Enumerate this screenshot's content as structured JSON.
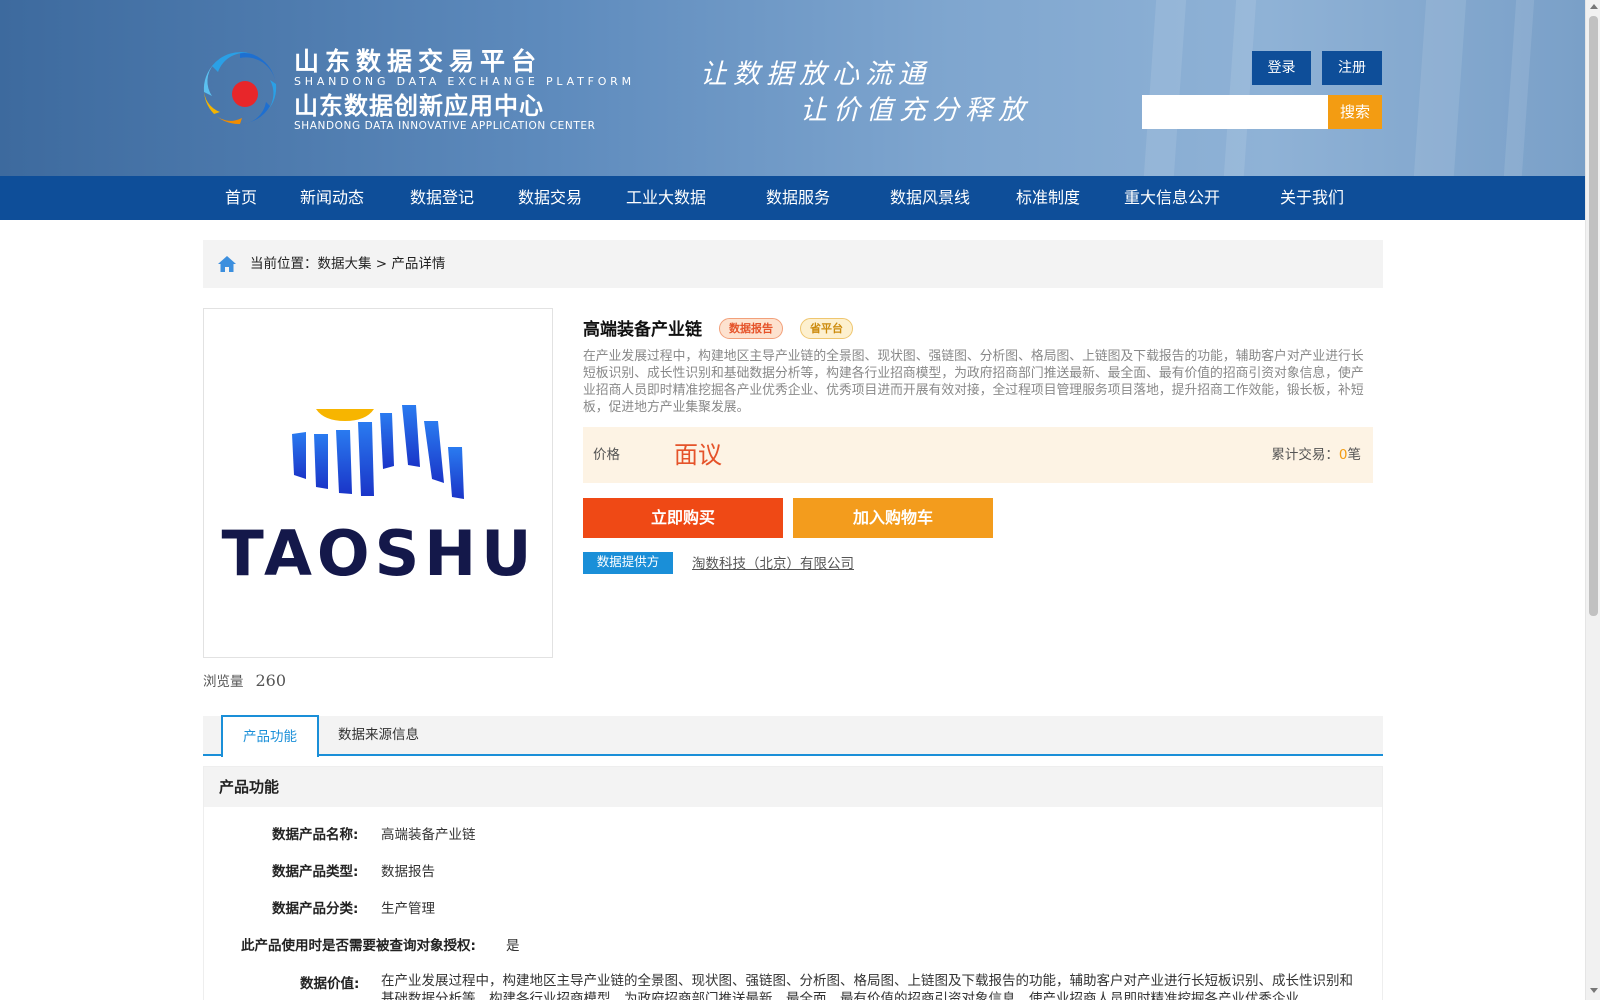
{
  "header": {
    "brand": {
      "line1": "山东数据交易平台",
      "line2": "SHANDONG DATA EXCHANGE PLATFORM",
      "line3": "山东数据创新应用中心",
      "line4": "SHANDONG DATA INNOVATIVE APPLICATION CENTER"
    },
    "slogan": {
      "line1": "让数据放心流通",
      "line2": "让价值充分释放"
    },
    "login_label": "登录",
    "register_label": "注册",
    "search_placeholder": "",
    "search_label": "搜索"
  },
  "nav": {
    "items": [
      {
        "label": "首页"
      },
      {
        "label": "新闻动态"
      },
      {
        "label": "数据登记"
      },
      {
        "label": "数据交易"
      },
      {
        "label": "工业大数据"
      },
      {
        "label": "数据服务"
      },
      {
        "label": "数据风景线"
      },
      {
        "label": "标准制度"
      },
      {
        "label": "重大信息公开"
      },
      {
        "label": "关于我们"
      }
    ]
  },
  "breadcrumb": {
    "prefix": "当前位置：",
    "level1": "数据大集",
    "separator": " > ",
    "level2": "产品详情"
  },
  "product": {
    "image_text": "TAOSHU",
    "views_label": "浏览量",
    "views_count": "260",
    "title": "高端装备产业链",
    "tags": [
      "数据报告",
      "省平台"
    ],
    "description": "在产业发展过程中，构建地区主导产业链的全景图、现状图、强链图、分析图、格局图、上链图及下载报告的功能，辅助客户对产业进行长短板识别、成长性识别和基础数据分析等，构建各行业招商模型，为政府招商部门推送最新、最全面、最有价值的招商引资对象信息，使产业招商人员即时精准挖掘各产业优秀企业、优秀项目进而开展有效对接，全过程项目管理服务项目落地，提升招商工作效能，锻长板，补短板，促进地方产业集聚发展。",
    "price_label": "价格",
    "price_value": "面议",
    "trade_label": "累计交易：",
    "trade_count": "0",
    "trade_unit": "笔",
    "buy_label": "立即购买",
    "cart_label": "加入购物车",
    "provider_label": "数据提供方",
    "provider_name": "淘数科技（北京）有限公司"
  },
  "tabs": [
    {
      "label": "产品功能",
      "active": true
    },
    {
      "label": "数据来源信息",
      "active": false
    }
  ],
  "features": {
    "title": "产品功能",
    "rows": [
      {
        "label": "数据产品名称:",
        "value": "高端装备产业链"
      },
      {
        "label": "数据产品类型:",
        "value": "数据报告"
      },
      {
        "label": "数据产品分类:",
        "value": "生产管理"
      },
      {
        "label": "此产品使用时是否需要被查询对象授权:",
        "value": "是"
      },
      {
        "label": "数据价值:",
        "value": "在产业发展过程中，构建地区主导产业链的全景图、现状图、强链图、分析图、格局图、上链图及下载报告的功能，辅助客户对产业进行长短板识别、成长性识别和基础数据分析等，构建各行业招商模型，为政府招商部门推送最新、最全面、最有价值的招商引资对象信息，使产业招商人员即时精准挖掘各产业优秀企业"
      }
    ]
  },
  "colors": {
    "nav_bg": "#0e4e99",
    "accent_blue": "#1a8fd8",
    "buy_red": "#ef4915",
    "cart_orange": "#f39c1d",
    "search_orange": "#f39c12",
    "price_red": "#e5532a"
  },
  "icons": {
    "home": "home-icon",
    "logo": "swirl-logo-icon"
  }
}
